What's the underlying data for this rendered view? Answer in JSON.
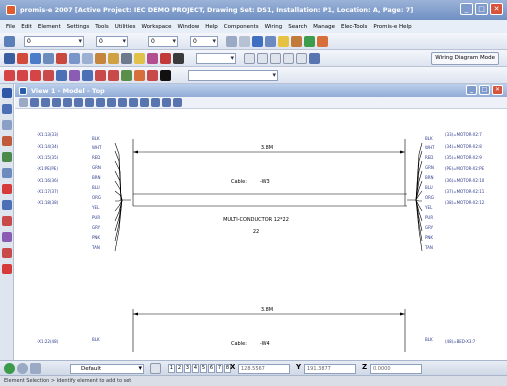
{
  "window": {
    "title": "promis-e 2007 [Active Project: IEC DEMO PROJECT, Drawing Set: DS1, Installation: P1, Location: A, Page: 7]",
    "minimize": "_",
    "maximize": "□",
    "close": "✕"
  },
  "menu": [
    "File",
    "Edit",
    "Element",
    "Settings",
    "Tools",
    "Utilities",
    "Workspace",
    "Window",
    "Help",
    "Components",
    "Wiring",
    "Search",
    "Manage",
    "Elec-Tools",
    "Promis-e Help"
  ],
  "toolbar": {
    "level_value": "0",
    "color_value": "0",
    "style_value": "0",
    "weight_value": "0",
    "wiring_mode_label": "Wiring Diagram Mode"
  },
  "view": {
    "title": "View 1 - Model - Top",
    "minimize": "_",
    "maximize": "□",
    "close": "✕"
  },
  "diagram": {
    "left_terminals": [
      "-X1:13(33)",
      "-X1:14(34)",
      "-X1:15(35)",
      "-X1:PE(PE)",
      "-X1:16(36)",
      "-X1:17(37)",
      "-X1:18(38)"
    ],
    "right_terminals": [
      "(33)=MOTOR-X2:7",
      "(34)=MOTOR-X2:8",
      "(35)=MOTOR-X2:9",
      "(PE)=MOTOR-X2:PE",
      "(36)=MOTOR-X2:10",
      "(37)=MOTOR-X2:11",
      "(38)=MOTOR-X2:12"
    ],
    "wire_colors": [
      "BLK",
      "WHT",
      "RED",
      "GRN",
      "BRN",
      "BLU",
      "ORG",
      "YEL",
      "PUR",
      "GRY",
      "PNK",
      "TAN"
    ],
    "cable1": {
      "length": "3.8M",
      "label": "Cable:",
      "name": "-W3",
      "type": "MULTI-CONDUCTOR 12*22",
      "count": "22"
    },
    "cable2": {
      "length": "3.8M",
      "label": "Cable:",
      "name": "-W4",
      "left_terminal": "-X1:22(48)",
      "right_terminal": "(48)=BED-X3:7",
      "wire_color": "BLK"
    }
  },
  "bottombar": {
    "model": "Default",
    "page_numbers": [
      "1",
      "2",
      "3",
      "4",
      "5",
      "6",
      "7",
      "8"
    ],
    "x_label": "X",
    "x_value": "128.5567",
    "y_label": "Y",
    "y_value": "191.3877",
    "z_label": "Z",
    "z_value": "0.0000"
  },
  "status": "Element Selection > Identify element to add to set"
}
